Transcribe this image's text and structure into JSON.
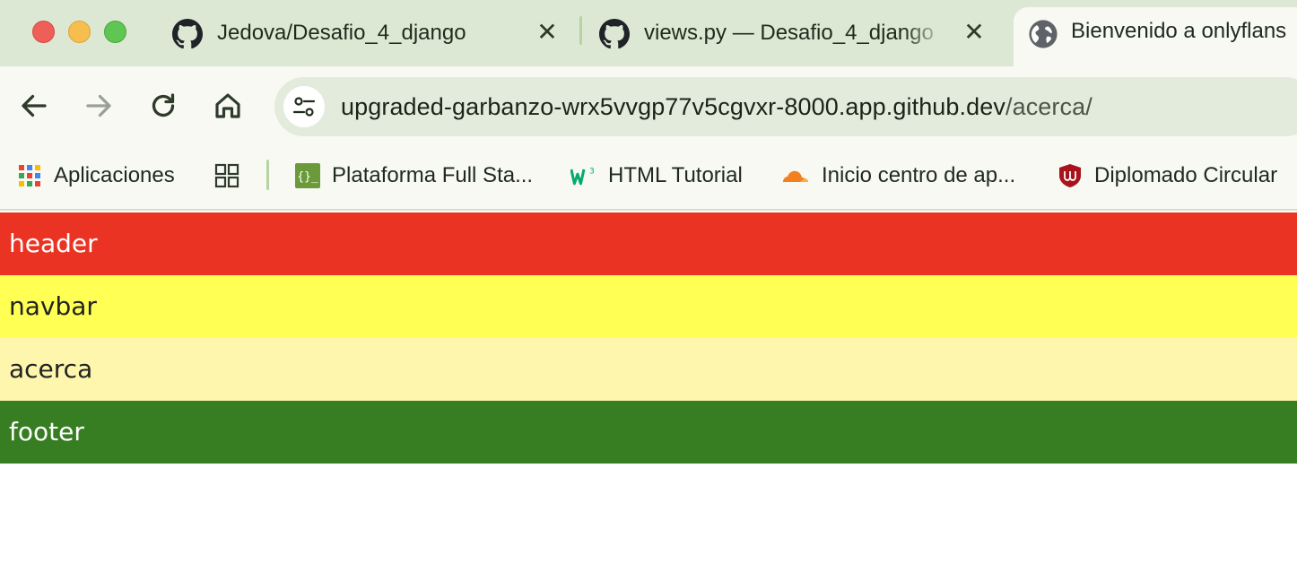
{
  "browser": {
    "tabs": [
      {
        "title": "Jedova/Desafio_4_django",
        "icon": "github-icon",
        "active": false
      },
      {
        "title": "views.py — Desafio_4_django",
        "icon": "github-icon",
        "active": false
      },
      {
        "title": "Bienvenido a onlyflans",
        "icon": "globe-icon",
        "active": true
      }
    ],
    "close_glyph": "✕",
    "omnibox": {
      "host": "upgraded-garbanzo-wrx5vvgp77v5cgvxr-8000.app.github.dev",
      "path": "/acerca/"
    },
    "bookmarks": [
      {
        "label": "Aplicaciones",
        "icon": "apps-grid-icon"
      },
      {
        "label": "",
        "icon": "tab-groups-icon"
      },
      {
        "label": "Plataforma Full Sta...",
        "icon": "code-braces-icon"
      },
      {
        "label": "HTML Tutorial",
        "icon": "w3schools-icon"
      },
      {
        "label": "Inicio centro de ap...",
        "icon": "cloud-icon"
      },
      {
        "label": "Diplomado Circular",
        "icon": "shield-logo-icon"
      }
    ]
  },
  "page": {
    "sections": [
      {
        "label": "header",
        "color": "#ea3323"
      },
      {
        "label": "navbar",
        "color": "#ffff54"
      },
      {
        "label": "acerca",
        "color": "#fdf6ac"
      },
      {
        "label": "footer",
        "color": "#377d22"
      }
    ]
  }
}
